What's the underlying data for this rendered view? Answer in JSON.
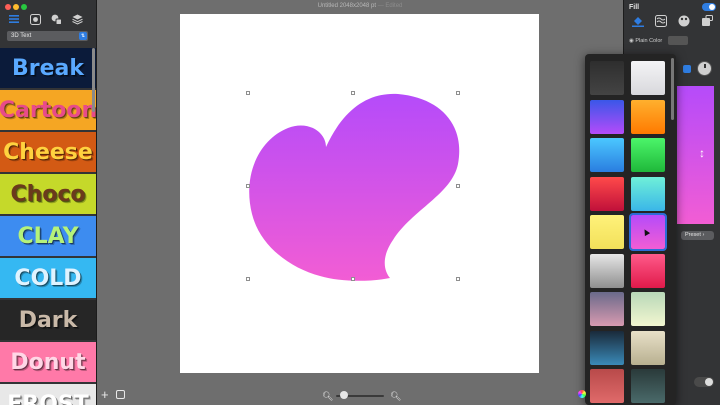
{
  "window": {
    "title": "Untitled 2048x2048 pt",
    "status": "— Edited"
  },
  "traffic_lights": [
    "#ff5f57",
    "#febc2e",
    "#28c840"
  ],
  "sidebar": {
    "toolbar_icons": [
      "list-icon",
      "image-icon",
      "shapes-icon",
      "layers-icon"
    ],
    "style_select": "3D Text",
    "styles": [
      {
        "label": "Break",
        "bg": "#0b1b3a",
        "fg": "#5aa9ff"
      },
      {
        "label": "Cartoon",
        "bg": "#f5a623",
        "fg": "#e84b8a"
      },
      {
        "label": "Cheese",
        "bg": "#d35a14",
        "fg": "#ffd23f"
      },
      {
        "label": "Choco",
        "bg": "#c5d92a",
        "fg": "#6b3a1c"
      },
      {
        "label": "CLAY",
        "bg": "#3d8cf0",
        "fg": "#b5f27a"
      },
      {
        "label": "COLD",
        "bg": "#35b8f2",
        "fg": "#dff3ff"
      },
      {
        "label": "Dark",
        "bg": "#262626",
        "fg": "#c9b9a8"
      },
      {
        "label": "Donut",
        "bg": "#ff79a8",
        "fg": "#ffd7e6"
      },
      {
        "label": "FROST",
        "bg": "#e8e8e8",
        "fg": "#ffffff"
      }
    ]
  },
  "canvas": {
    "shape_gradient": [
      "#b54bfa",
      "#f25dd4"
    ]
  },
  "inspector": {
    "title": "Fill",
    "icons": [
      "fill-bucket-icon",
      "texture-icon",
      "palette-icon",
      "image-fill-icon"
    ],
    "plain_color_label": "Plain Color",
    "preset_label": "Preset"
  },
  "gradient_presets": [
    [
      "#2e2e2e",
      "#444444"
    ],
    [
      "#f4f4f6",
      "#d8d8dc"
    ],
    [
      "#3a57e8",
      "#b54bfa"
    ],
    [
      "#ffb02e",
      "#ff7a00"
    ],
    [
      "#4bc8ff",
      "#2a7de0"
    ],
    [
      "#4cf56a",
      "#1fb83a"
    ],
    [
      "#ff4a4a",
      "#c0103a"
    ],
    [
      "#6ff0d8",
      "#3ab6e8"
    ],
    [
      "#fff27a",
      "#f2e05a"
    ],
    [
      "#b54bfa",
      "#f25dd4"
    ],
    [
      "#e6e6e6",
      "#8f8f8f"
    ],
    [
      "#ff5a8a",
      "#e01a4a"
    ],
    [
      "#6a6a8a",
      "#d89ab0"
    ],
    [
      "#b8d8b8",
      "#f2f6d0"
    ],
    [
      "#1a2a3a",
      "#3a8ab8"
    ],
    [
      "#e8e0c8",
      "#b8b090"
    ],
    [
      "#b84a4a",
      "#e06a6a"
    ],
    [
      "#2a3a3a",
      "#4a6a6a"
    ]
  ]
}
